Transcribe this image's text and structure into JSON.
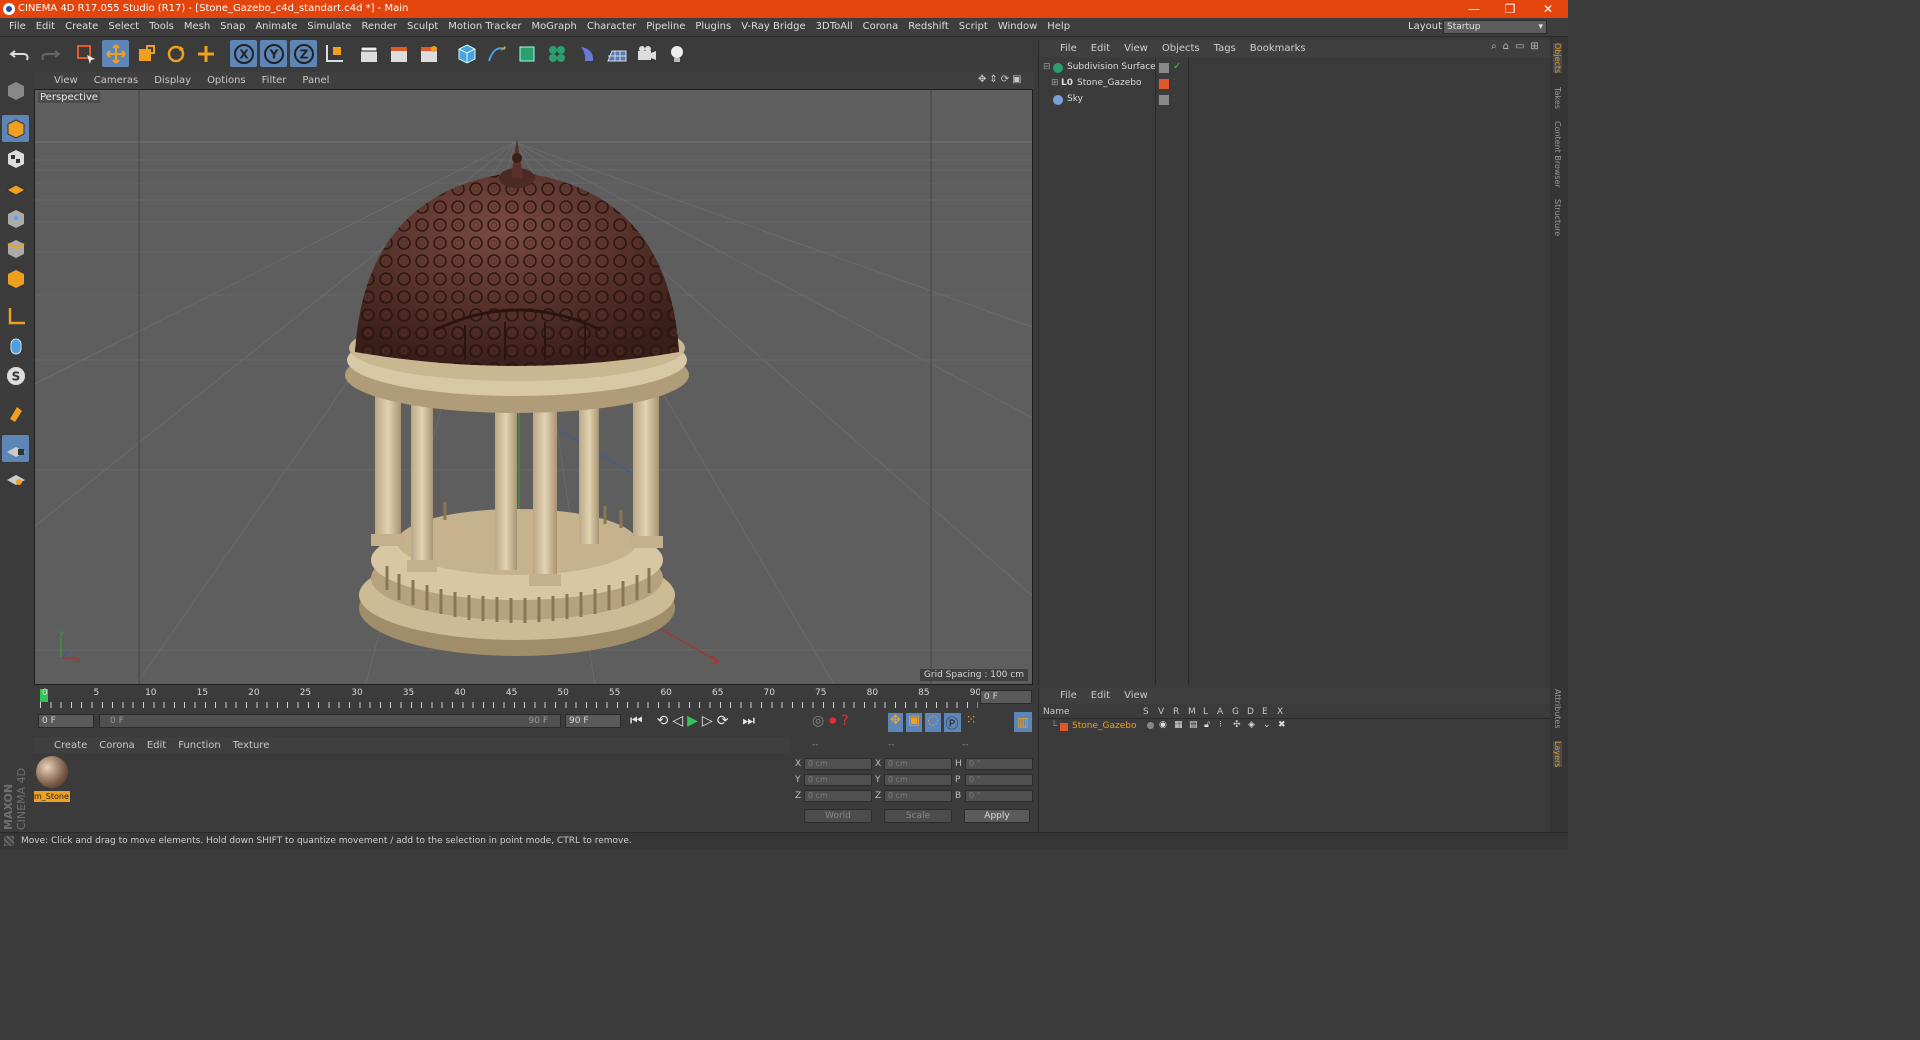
{
  "window": {
    "title": "CINEMA 4D R17.055 Studio (R17) - [Stone_Gazebo_c4d_standart.c4d *] - Main",
    "minimize": "—",
    "maximize": "❐",
    "close": "✕"
  },
  "menubar": {
    "items": [
      "File",
      "Edit",
      "Create",
      "Select",
      "Tools",
      "Mesh",
      "Snap",
      "Animate",
      "Simulate",
      "Render",
      "Sculpt",
      "Motion Tracker",
      "MoGraph",
      "Character",
      "Pipeline",
      "Plugins",
      "V-Ray Bridge",
      "3DToAll",
      "Corona",
      "Redshift",
      "Script",
      "Window",
      "Help"
    ],
    "layout_label": "Layout:",
    "layout_value": "Startup"
  },
  "toolbar": {
    "axis_x": "X",
    "axis_y": "Y",
    "axis_z": "Z"
  },
  "viewport": {
    "menu": [
      "View",
      "Cameras",
      "Display",
      "Options",
      "Filter",
      "Panel"
    ],
    "label": "Perspective",
    "grid_spacing": "Grid Spacing : 100 cm"
  },
  "timeline": {
    "ticks": [
      "0",
      "5",
      "10",
      "15",
      "20",
      "25",
      "30",
      "35",
      "40",
      "45",
      "50",
      "55",
      "60",
      "65",
      "70",
      "75",
      "80",
      "85",
      "90"
    ],
    "current_frame": "0 F",
    "start_field": "0 F",
    "range_start": "0 F",
    "range_end": "90 F",
    "end_field": "90 F"
  },
  "material_manager": {
    "menu": [
      "Create",
      "Corona",
      "Edit",
      "Function",
      "Texture"
    ],
    "materials": [
      {
        "label": "m_Stone"
      }
    ]
  },
  "coordinates": {
    "headers": [
      "--",
      "--",
      "--"
    ],
    "rows": [
      {
        "l1": "X",
        "v1": "0 cm",
        "l2": "X",
        "v2": "0 cm",
        "l3": "H",
        "v3": "0 °"
      },
      {
        "l1": "Y",
        "v1": "0 cm",
        "l2": "Y",
        "v2": "0 cm",
        "l3": "P",
        "v3": "0 °"
      },
      {
        "l1": "Z",
        "v1": "0 cm",
        "l2": "Z",
        "v2": "0 cm",
        "l3": "B",
        "v3": "0 °"
      }
    ],
    "mode": "World",
    "transform": "Scale",
    "apply": "Apply"
  },
  "object_manager": {
    "menu": [
      "File",
      "Edit",
      "View",
      "Objects",
      "Tags",
      "Bookmarks"
    ],
    "objects": [
      {
        "name": "Subdivision Surface"
      },
      {
        "name": "Stone_Gazebo"
      },
      {
        "name": "Sky"
      }
    ]
  },
  "layer_manager": {
    "menu": [
      "File",
      "Edit",
      "View"
    ],
    "columns": [
      "Name",
      "S",
      "V",
      "R",
      "M",
      "L",
      "A",
      "G",
      "D",
      "E",
      "X"
    ],
    "layers": [
      {
        "name": "Stone_Gazebo",
        "color": "#e0582a"
      }
    ]
  },
  "right_tabs": {
    "top": [
      "Objects",
      "Takes",
      "Content Browser",
      "Structure"
    ],
    "bottom": [
      "Attributes",
      "Layers"
    ]
  },
  "logo": {
    "brand": "MAXON",
    "product": "CINEMA 4D"
  },
  "status": {
    "text": "Move: Click and drag to move elements. Hold down SHIFT to quantize movement / add to the selection in point mode, CTRL to remove."
  },
  "colors": {
    "titlebar": "#e3450d",
    "highlight": "#5d86b7",
    "layer_orange": "#e0582a",
    "active_tab": "#e09a2a"
  }
}
